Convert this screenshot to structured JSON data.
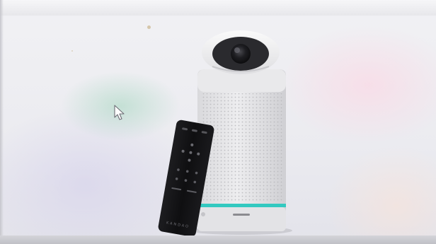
{
  "photo": {
    "subject": "speakerphone-with-camera-and-remote",
    "remote_brand": "KANDAO"
  },
  "colors": {
    "device_body": "#e6e6e8",
    "camera_head": "#f2f2f3",
    "lens": "#1c1c1f",
    "accent_strip": "#33c9c0",
    "remote": "#121214"
  },
  "icons": {
    "cursor": "pointer-arrow-icon"
  }
}
